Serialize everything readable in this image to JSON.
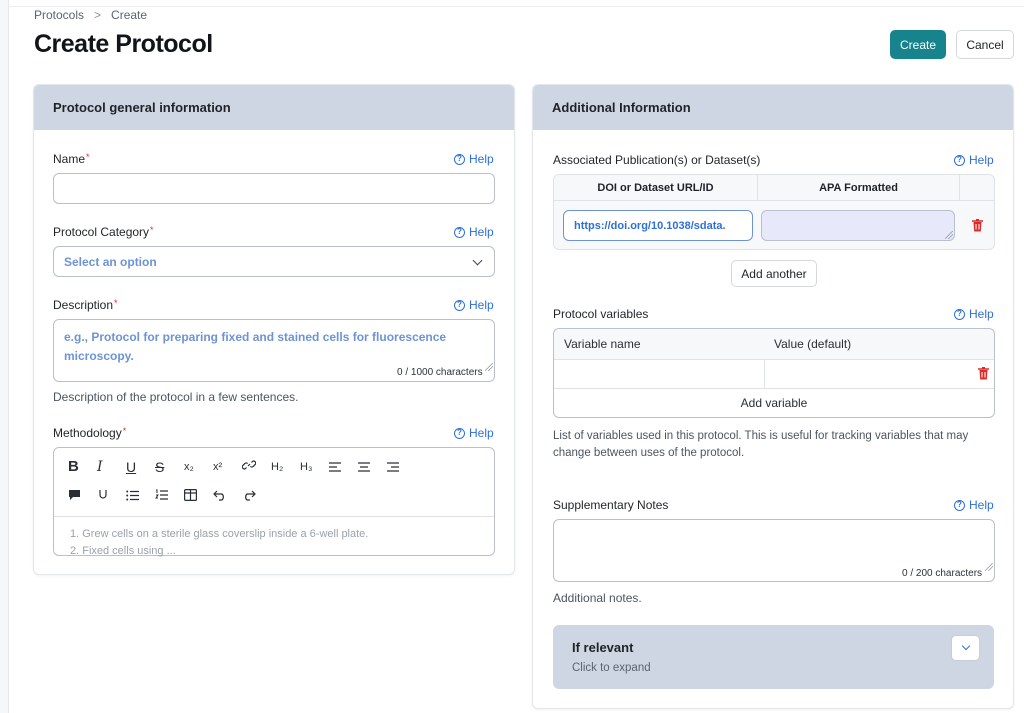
{
  "breadcrumb": {
    "root": "Protocols",
    "separator": ">",
    "current": "Create"
  },
  "page": {
    "title": "Create Protocol"
  },
  "actions": {
    "create_label": "Create",
    "cancel_label": "Cancel"
  },
  "general": {
    "header": "Protocol general information",
    "help_label": "Help",
    "name": {
      "label": "Name",
      "value": ""
    },
    "category": {
      "label": "Protocol Category",
      "placeholder": "Select an option"
    },
    "description": {
      "label": "Description",
      "placeholder": "e.g., Protocol for preparing fixed and stained cells for fluorescence microscopy.",
      "counter": "0 / 1000 characters",
      "hint": "Description of the protocol in a few sentences."
    },
    "methodology": {
      "label": "Methodology",
      "toolbar_row1": [
        "B",
        "I",
        "U",
        "S",
        "X₂",
        "X²",
        "link",
        "H2",
        "H3",
        "align-left",
        "align-center",
        "align-right"
      ],
      "placeholder_line1": "1. Grew cells on a sterile glass coverslip inside a 6-well plate.",
      "placeholder_line2": "2. Fixed cells using ..."
    }
  },
  "additional": {
    "header": "Additional Information",
    "help_label": "Help",
    "publications": {
      "label": "Associated Publication(s) or Dataset(s)",
      "col_doi": "DOI or Dataset URL/ID",
      "col_apa": "APA Formatted",
      "doi_placeholder": "https://doi.org/10.1038/sdata.",
      "add_label": "Add another"
    },
    "variables": {
      "label": "Protocol variables",
      "col_name": "Variable name",
      "col_value": "Value (default)",
      "add_label": "Add variable",
      "hint": "List of variables used in this protocol. This is useful for tracking variables that may change between uses of the protocol."
    },
    "notes": {
      "label": "Supplementary Notes",
      "counter": "0 / 200 characters",
      "hint": "Additional notes."
    },
    "relevant": {
      "title": "If relevant",
      "subtitle": "Click to expand"
    }
  },
  "colors": {
    "accent": "#17838c",
    "header_bg": "#cfd6e3",
    "link": "#2f6fd8",
    "danger": "#d92d2d"
  }
}
